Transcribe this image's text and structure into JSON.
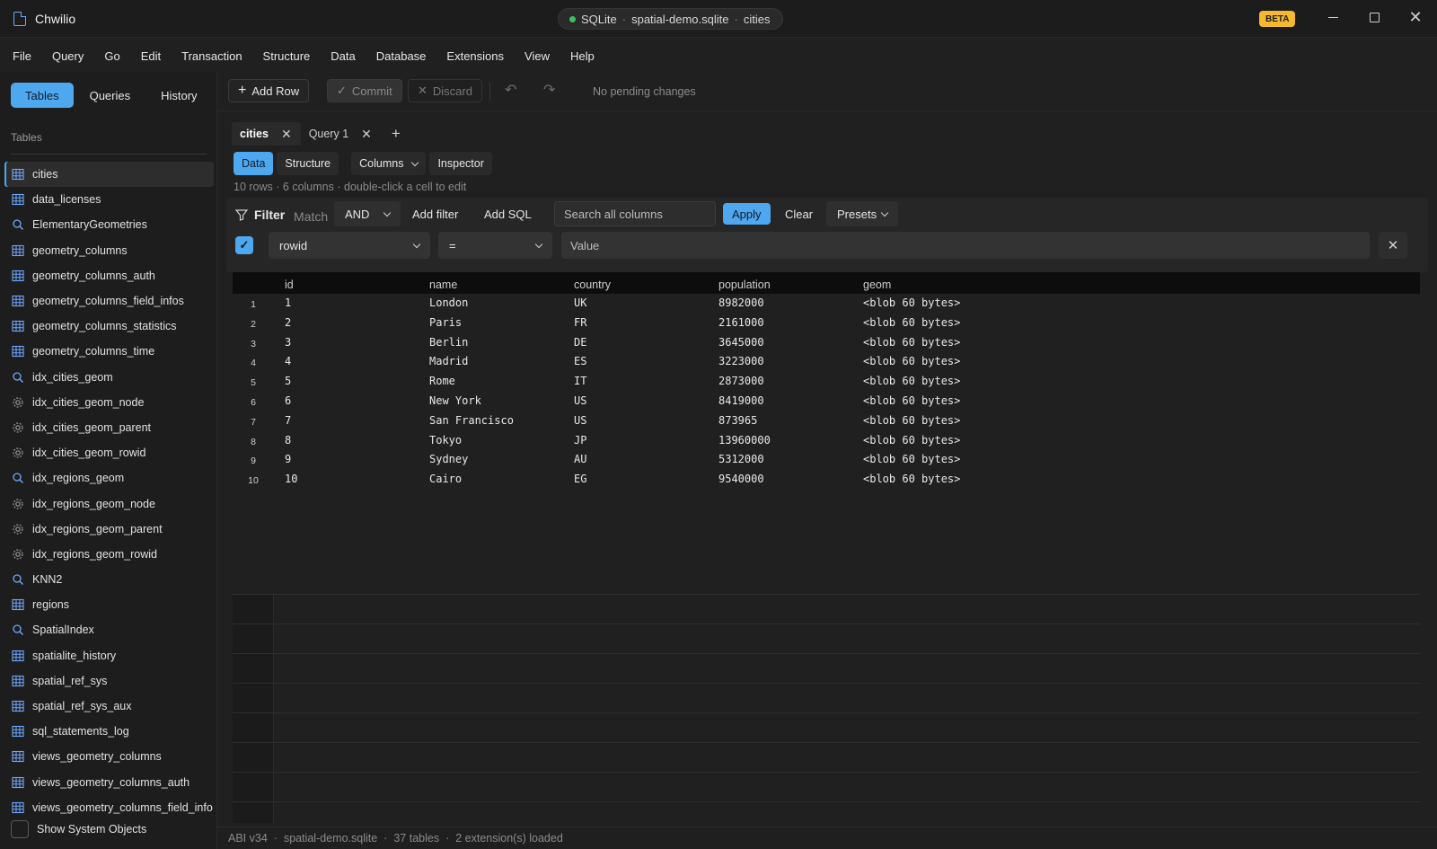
{
  "app": {
    "title": "Chwilio",
    "beta": "BETA"
  },
  "connection": {
    "engine": "SQLite",
    "file": "spatial-demo.sqlite",
    "table": "cities",
    "status_color": "#3fbf5f"
  },
  "menu": [
    "File",
    "Query",
    "Go",
    "Edit",
    "Transaction",
    "Structure",
    "Data",
    "Database",
    "Extensions",
    "View",
    "Help"
  ],
  "sidebar": {
    "tabs": [
      "Tables",
      "Queries",
      "History"
    ],
    "active_tab": "Tables",
    "heading": "Tables",
    "items": [
      {
        "label": "cities",
        "icon": "table-icon",
        "selected": true
      },
      {
        "label": "data_licenses",
        "icon": "table-icon"
      },
      {
        "label": "ElementaryGeometries",
        "icon": "search-icon"
      },
      {
        "label": "geometry_columns",
        "icon": "table-icon"
      },
      {
        "label": "geometry_columns_auth",
        "icon": "table-icon"
      },
      {
        "label": "geometry_columns_field_infos",
        "icon": "table-icon"
      },
      {
        "label": "geometry_columns_statistics",
        "icon": "table-icon"
      },
      {
        "label": "geometry_columns_time",
        "icon": "table-icon"
      },
      {
        "label": "idx_cities_geom",
        "icon": "search-icon"
      },
      {
        "label": "idx_cities_geom_node",
        "icon": "gear-icon"
      },
      {
        "label": "idx_cities_geom_parent",
        "icon": "gear-icon"
      },
      {
        "label": "idx_cities_geom_rowid",
        "icon": "gear-icon"
      },
      {
        "label": "idx_regions_geom",
        "icon": "search-icon"
      },
      {
        "label": "idx_regions_geom_node",
        "icon": "gear-icon"
      },
      {
        "label": "idx_regions_geom_parent",
        "icon": "gear-icon"
      },
      {
        "label": "idx_regions_geom_rowid",
        "icon": "gear-icon"
      },
      {
        "label": "KNN2",
        "icon": "search-icon"
      },
      {
        "label": "regions",
        "icon": "table-icon"
      },
      {
        "label": "SpatialIndex",
        "icon": "search-icon"
      },
      {
        "label": "spatialite_history",
        "icon": "table-icon"
      },
      {
        "label": "spatial_ref_sys",
        "icon": "table-icon"
      },
      {
        "label": "spatial_ref_sys_aux",
        "icon": "table-icon"
      },
      {
        "label": "sql_statements_log",
        "icon": "table-icon"
      },
      {
        "label": "views_geometry_columns",
        "icon": "table-icon"
      },
      {
        "label": "views_geometry_columns_auth",
        "icon": "table-icon"
      },
      {
        "label": "views_geometry_columns_field_info",
        "icon": "table-icon"
      }
    ],
    "show_system_label": "Show System Objects"
  },
  "toolbar": {
    "add_row": "Add Row",
    "commit": "Commit",
    "discard": "Discard",
    "status": "No pending changes"
  },
  "doc_tabs": [
    {
      "label": "cities",
      "active": true
    },
    {
      "label": "Query 1",
      "active": false
    }
  ],
  "views": {
    "data": "Data",
    "structure": "Structure",
    "columns": "Columns",
    "inspector": "Inspector"
  },
  "meta": {
    "rows": "10 rows",
    "columns": "6 columns",
    "hint": "double-click a cell to edit"
  },
  "filter": {
    "label": "Filter",
    "match": "Match",
    "mode": "AND",
    "add_filter": "Add filter",
    "add_sql": "Add SQL",
    "search_placeholder": "Search all columns",
    "apply": "Apply",
    "clear": "Clear",
    "presets": "Presets",
    "column": "rowid",
    "operator": "=",
    "value_placeholder": "Value"
  },
  "grid": {
    "columns": [
      "id",
      "name",
      "country",
      "population",
      "geom"
    ],
    "rows": [
      [
        "1",
        "1",
        "London",
        "UK",
        "8982000",
        "<blob 60 bytes>"
      ],
      [
        "2",
        "2",
        "Paris",
        "FR",
        "2161000",
        "<blob 60 bytes>"
      ],
      [
        "3",
        "3",
        "Berlin",
        "DE",
        "3645000",
        "<blob 60 bytes>"
      ],
      [
        "4",
        "4",
        "Madrid",
        "ES",
        "3223000",
        "<blob 60 bytes>"
      ],
      [
        "5",
        "5",
        "Rome",
        "IT",
        "2873000",
        "<blob 60 bytes>"
      ],
      [
        "6",
        "6",
        "New York",
        "US",
        "8419000",
        "<blob 60 bytes>"
      ],
      [
        "7",
        "7",
        "San Francisco",
        "US",
        "873965",
        "<blob 60 bytes>"
      ],
      [
        "8",
        "8",
        "Tokyo",
        "JP",
        "13960000",
        "<blob 60 bytes>"
      ],
      [
        "9",
        "9",
        "Sydney",
        "AU",
        "5312000",
        "<blob 60 bytes>"
      ],
      [
        "10",
        "10",
        "Cairo",
        "EG",
        "9540000",
        "<blob 60 bytes>"
      ]
    ]
  },
  "statusbar": [
    "ABI v34",
    "spatial-demo.sqlite",
    "37 tables",
    "2 extension(s) loaded"
  ],
  "colors": {
    "accent": "#4ea8f0",
    "beta": "#f5b82e",
    "bg": "#202020"
  }
}
